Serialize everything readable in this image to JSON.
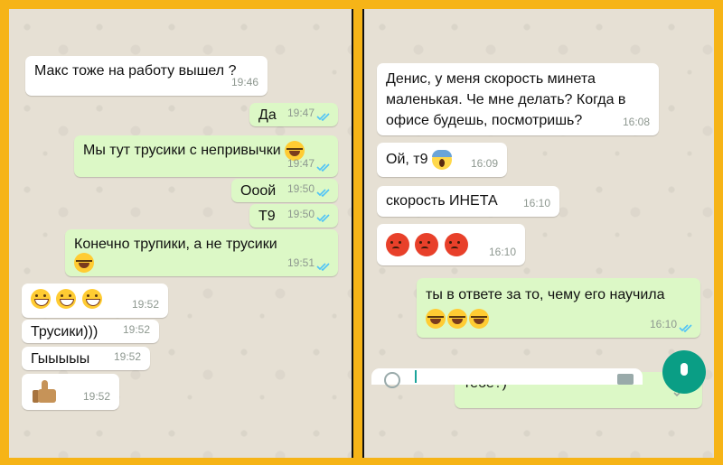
{
  "left_chat": {
    "messages": [
      {
        "text": "Макс тоже на работу вышел ?",
        "time": "19:46"
      },
      {
        "text": "Да",
        "time": "19:47"
      },
      {
        "text": "Мы тут трусики с непривычки",
        "time": "19:47"
      },
      {
        "text": "Ооой",
        "time": "19:50"
      },
      {
        "text": "Т9",
        "time": "19:50"
      },
      {
        "text": "Конечно трупики, а не трусики",
        "time": "19:51"
      },
      {
        "text": "",
        "time": "19:52"
      },
      {
        "text": "Трусики)))",
        "time": "19:52"
      },
      {
        "text": "Гыыыыы",
        "time": "19:52"
      },
      {
        "text": "",
        "time": "19:52"
      }
    ]
  },
  "right_chat": {
    "messages": [
      {
        "text": "Денис, у меня скорость минета маленькая. Че мне делать? Когда в офисе будешь, посмотришь?",
        "time": "16:08"
      },
      {
        "text": "Ой, т9",
        "time": "16:09"
      },
      {
        "text": "скорость ИНЕТА",
        "time": "16:10"
      },
      {
        "text": "",
        "time": "16:10"
      },
      {
        "text": "ты в ответе за то, чему его научила",
        "time": "16:10"
      },
      {
        "text": "тебе?)",
        "time": ""
      }
    ]
  },
  "colors": {
    "frame": "#f6b417",
    "outgoing_bubble": "#dcf8c6",
    "incoming_bubble": "#ffffff",
    "read_ticks": "#4fc3f7",
    "mic_button": "#0a9e85"
  }
}
